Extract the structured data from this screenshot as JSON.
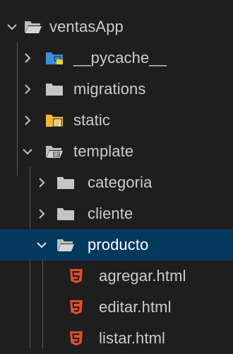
{
  "explorer": {
    "items": [
      {
        "label": "ventasApp",
        "icon": "folder-open-icon",
        "expanded": true
      },
      {
        "label": "__pycache__",
        "icon": "python-folder-icon",
        "expanded": false
      },
      {
        "label": "migrations",
        "icon": "folder-icon",
        "expanded": false
      },
      {
        "label": "static",
        "icon": "static-folder-icon",
        "expanded": false
      },
      {
        "label": "template",
        "icon": "template-folder-open-icon",
        "expanded": true
      },
      {
        "label": "categoria",
        "icon": "folder-icon",
        "expanded": false
      },
      {
        "label": "cliente",
        "icon": "folder-icon",
        "expanded": false
      },
      {
        "label": "producto",
        "icon": "folder-open-icon",
        "expanded": true,
        "selected": true
      },
      {
        "label": "agregar.html",
        "icon": "html5-icon"
      },
      {
        "label": "editar.html",
        "icon": "html5-icon"
      },
      {
        "label": "listar.html",
        "icon": "html5-icon"
      }
    ]
  },
  "colors": {
    "background": "#1e1e1e",
    "selection": "#04395e",
    "folder": "#c5c5c5",
    "html": "#e44d26",
    "static_folder": "#f2b631",
    "python_blue": "#3b8fd6",
    "python_yellow": "#f6d12e"
  }
}
